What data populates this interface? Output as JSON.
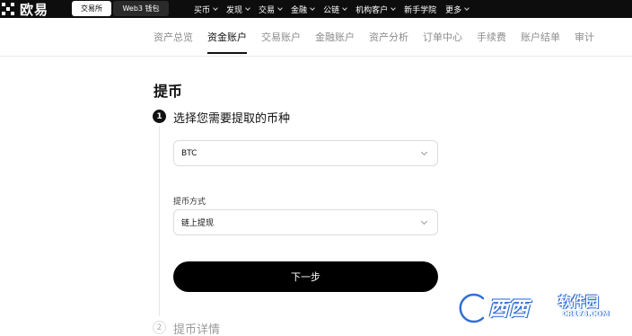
{
  "header": {
    "brand": "欧易",
    "segments": {
      "exchange": "交易所",
      "web3": "Web3 钱包"
    },
    "nav": [
      "买币",
      "发现",
      "交易",
      "金融",
      "公链",
      "机构客户",
      "新手学院",
      "更多"
    ]
  },
  "subnav": {
    "items": [
      "资产总览",
      "资金账户",
      "交易账户",
      "金融账户",
      "资产分析",
      "订单中心",
      "手续费",
      "账户结单",
      "审计"
    ],
    "active": "资金账户"
  },
  "page": {
    "title": "提币",
    "step1": {
      "number": "1",
      "title": "选择您需要提取的币种"
    },
    "coin_select": {
      "value": "BTC"
    },
    "method": {
      "label": "提币方式",
      "value": "链上提现"
    },
    "next_button": "下一步",
    "step2": {
      "number": "2",
      "title": "提币详情"
    }
  },
  "watermark": {
    "brand": "西西",
    "suffix": "软件园",
    "url": "CR173.COM"
  },
  "colors": {
    "topbar": "#0d0d0d",
    "accent": "#000000",
    "muted": "#8c8c8c",
    "watermark": "#2f6fd6"
  }
}
